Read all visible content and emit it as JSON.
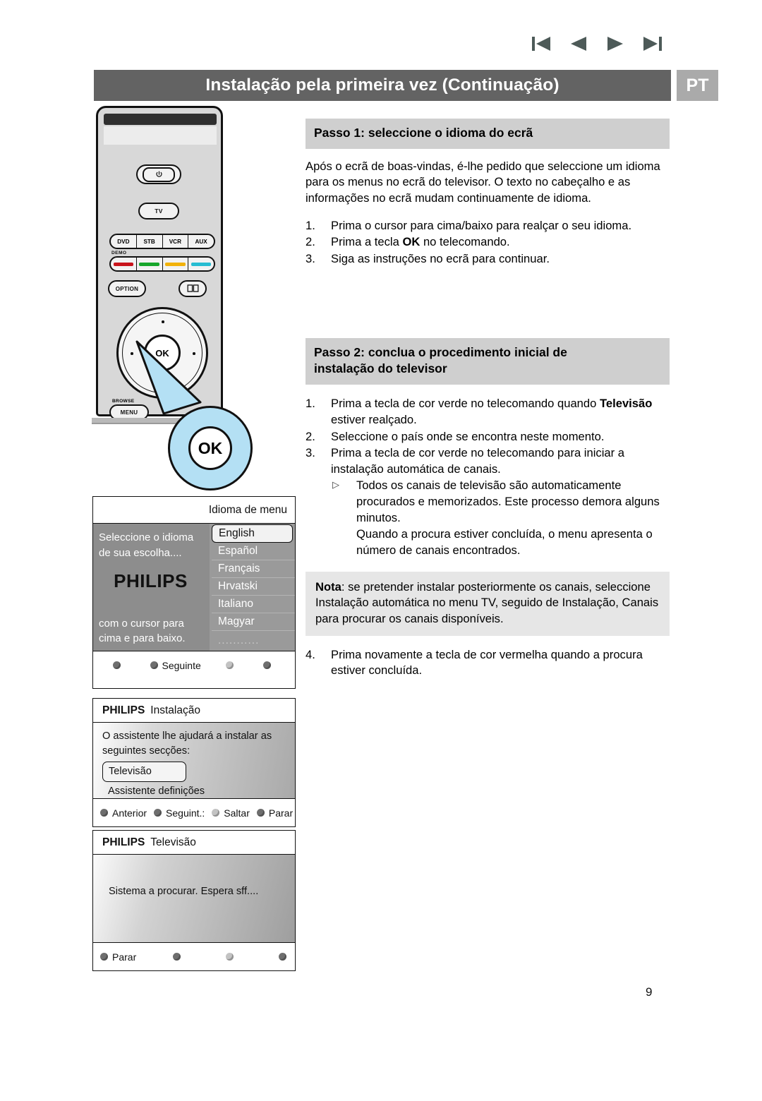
{
  "topnav": {
    "items": [
      {
        "name": "first-page-icon",
        "label": "First"
      },
      {
        "name": "previous-page-icon",
        "label": "Previous"
      },
      {
        "name": "next-page-icon",
        "label": "Next"
      },
      {
        "name": "last-page-icon",
        "label": "Last"
      }
    ]
  },
  "header": {
    "title": "Instalação pela primeira vez (Continuação)",
    "language_badge": "PT",
    "bar_color": "#636363",
    "badge_color": "#aaaaaa"
  },
  "step1": {
    "heading": "Passo 1: seleccione o idioma do ecrã",
    "paragraph": "Após o ecrã de boas-vindas, é-lhe pedido que seleccione um idioma para os menus no ecrã do televisor. O texto no cabeçalho e as informações no ecrã mudam continuamente de idioma.",
    "items": [
      {
        "num": "1.",
        "text": "Prima o cursor para cima/baixo para realçar o seu idioma."
      },
      {
        "num": "2.",
        "pre": "Prima a tecla ",
        "bold": "OK",
        "post": " no telecomando."
      },
      {
        "num": "3.",
        "text": "Siga as instruções no ecrã para continuar."
      }
    ]
  },
  "step2": {
    "heading_line1": "Passo 2: conclua o procedimento inicial de",
    "heading_line2": "instalação do televisor",
    "items": [
      {
        "num": "1.",
        "pre": "Prima a tecla de cor verde no telecomando quando ",
        "bold": "Televisão",
        "post": " estiver realçado."
      },
      {
        "num": "2.",
        "text": "Seleccione o país onde se encontra neste momento."
      },
      {
        "num": "3.",
        "text": "Prima a tecla de cor verde no telecomando para iniciar a instalação automática de canais."
      }
    ],
    "subitems": [
      {
        "marker": "▷",
        "text": "Todos os canais de televisão são automaticamente procurados e memorizados. Este processo demora alguns minutos."
      },
      {
        "marker": "",
        "text": "Quando a procura estiver concluída, o menu apresenta o número de canais encontrados."
      }
    ],
    "note": {
      "bold": "Nota",
      "text": ": se pretender instalar posteriormente os canais, seleccione Instalação automática no menu TV, seguido de Instalação, Canais para procurar os canais disponíveis."
    },
    "item4": {
      "num": "4.",
      "text": "Prima novamente a tecla de cor vermelha quando a procura estiver concluída."
    }
  },
  "remote": {
    "power_label": "⏻",
    "tv_label": "TV",
    "sources": [
      "DVD",
      "STB",
      "VCR",
      "AUX"
    ],
    "demo_label": "DEMO",
    "color_keys": [
      {
        "name": "red-color-key",
        "color": "#c9141b"
      },
      {
        "name": "green-color-key",
        "color": "#16a62b"
      },
      {
        "name": "yellow-color-key",
        "color": "#f2b20a"
      },
      {
        "name": "cyan-color-key",
        "color": "#27bdd2"
      }
    ],
    "option_label": "OPTION",
    "book_label": "▭▭",
    "ok_label": "OK",
    "browse_label": "BROWSE",
    "menu_label": "MENU",
    "callout_label": "OK",
    "callout_color": "#b4e0f4"
  },
  "tv_screens": {
    "language_menu": {
      "title": "Idioma de menu",
      "left_top_line1": "Seleccione o idioma",
      "left_top_line2": "de sua escolha....",
      "brand": "PHILIPS",
      "left_bottom_line1": "com o cursor para",
      "left_bottom_line2": "cima e para baixo.",
      "languages": [
        {
          "label": "English",
          "selected": true
        },
        {
          "label": "Español",
          "selected": false
        },
        {
          "label": "Français",
          "selected": false
        },
        {
          "label": "Hrvatski",
          "selected": false
        },
        {
          "label": "Italiano",
          "selected": false
        },
        {
          "label": "Magyar",
          "selected": false
        },
        {
          "label": "",
          "selected": false
        },
        {
          "label": "...........",
          "selected": false
        }
      ],
      "footer": [
        {
          "label": "",
          "faint": false
        },
        {
          "label": "Seguinte",
          "faint": false
        },
        {
          "label": "",
          "faint": true
        },
        {
          "label": "",
          "faint": false
        }
      ]
    },
    "installation": {
      "brand": "PHILIPS",
      "title": "Instalação",
      "body_line1": "O assistente lhe ajudará a instalar as",
      "body_line2": "seguintes secções:",
      "selected_item": "Televisão",
      "plain_item": "Assistente definições",
      "footer": [
        {
          "label": "Anterior",
          "faint": false
        },
        {
          "label": "Seguint.:",
          "faint": false
        },
        {
          "label": "Saltar",
          "faint": true
        },
        {
          "label": "Parar",
          "faint": false
        }
      ]
    },
    "searching": {
      "brand": "PHILIPS",
      "title": "Televisão",
      "body": "Sistema a procurar. Espera sff....",
      "footer": [
        {
          "label": "Parar",
          "faint": false
        },
        {
          "label": "",
          "faint": false
        },
        {
          "label": "",
          "faint": true
        },
        {
          "label": "",
          "faint": false
        }
      ]
    }
  },
  "footer": {
    "page_number": "9"
  }
}
